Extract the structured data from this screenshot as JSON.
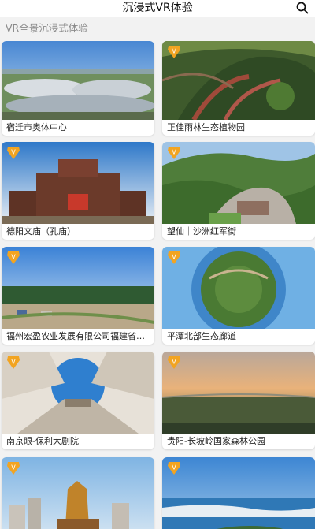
{
  "header": {
    "title": "沉浸式VR体验",
    "search_icon": "search-icon"
  },
  "subtitle": "VR全景沉浸式体验",
  "cards": [
    {
      "label": "宿迁市奥体中心",
      "badge": false
    },
    {
      "label": "正佳雨林生态植物园",
      "badge": true
    },
    {
      "label": "德阳文庙（孔庙）",
      "badge": true
    },
    {
      "label": "望仙｜沙洲红军街",
      "badge": true
    },
    {
      "label": "福州宏盈农业发展有限公司福建省…",
      "badge": true
    },
    {
      "label": "平潭北部生态廊道",
      "badge": true
    },
    {
      "label": "南京眼-保利大剧院",
      "badge": true
    },
    {
      "label": "贵阳-长坡岭国家森林公园",
      "badge": true
    },
    {
      "label": "",
      "badge": true
    },
    {
      "label": "",
      "badge": true
    }
  ],
  "colors": {
    "badge": "#f2a421",
    "background": "#f2f2f2"
  }
}
